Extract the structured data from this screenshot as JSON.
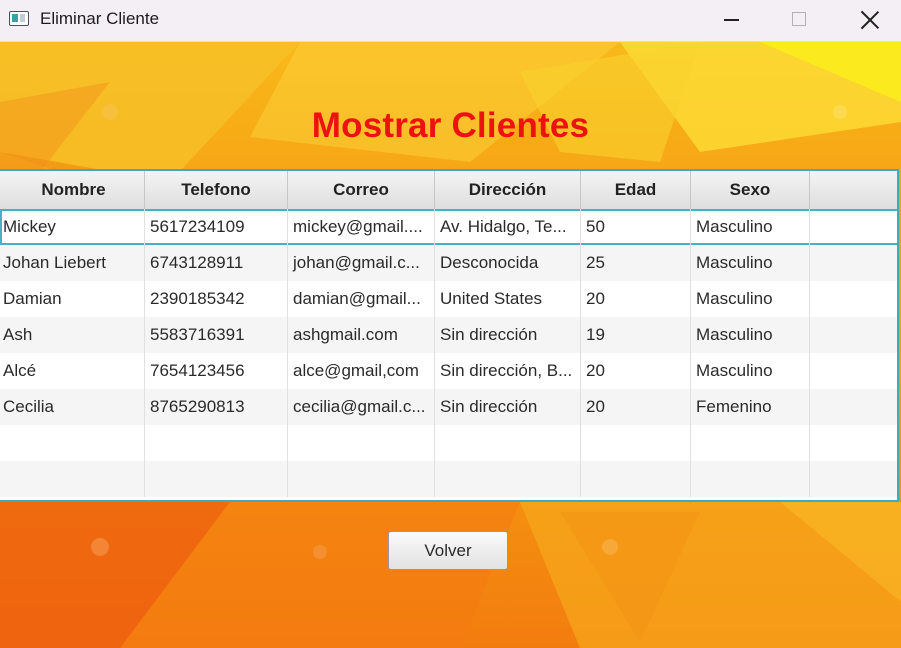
{
  "window": {
    "title": "Eliminar Cliente"
  },
  "page": {
    "title": "Mostrar Clientes",
    "title_color": "#ee1111"
  },
  "table": {
    "columns": [
      "Nombre",
      "Telefono",
      "Correo",
      "Dirección",
      "Edad",
      "Sexo",
      ""
    ],
    "rows": [
      [
        "Mickey",
        "5617234109",
        "mickey@gmail....",
        "Av. Hidalgo, Te...",
        "50",
        "Masculino"
      ],
      [
        "Johan Liebert",
        "6743128911",
        "johan@gmail.c...",
        "Desconocida",
        "25",
        "Masculino"
      ],
      [
        "Damian",
        "2390185342",
        "damian@gmail...",
        "United States",
        "20",
        "Masculino"
      ],
      [
        "Ash",
        "5583716391",
        "ashgmail.com",
        "Sin dirección",
        "19",
        "Masculino"
      ],
      [
        "Alcé",
        "7654123456",
        "alce@gmail,com",
        "Sin dirección, B...",
        "20",
        "Masculino"
      ],
      [
        "Cecilia",
        "8765290813",
        "cecilia@gmail.c...",
        "Sin dirección",
        "20",
        "Femenino"
      ]
    ],
    "selected_row": 0,
    "border_color": "#3ea9c0"
  },
  "actions": {
    "back_label": "Volver"
  },
  "icons": {
    "app": "app-window-icon",
    "minimize": "minimize-icon",
    "maximize": "maximize-icon",
    "close": "close-icon"
  }
}
